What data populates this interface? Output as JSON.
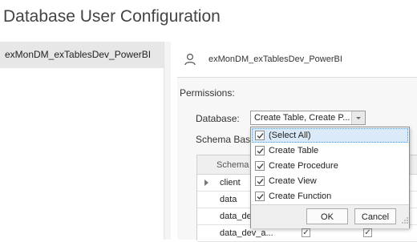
{
  "page": {
    "title": "Database User Configuration"
  },
  "users": {
    "items": [
      {
        "label": "exMonDM_exTablesDev_PowerBI",
        "selected": true
      }
    ]
  },
  "config": {
    "user_name": "exMonDM_exTablesDev_PowerBI",
    "permissions_label": "Permissions:",
    "database_label": "Database:",
    "database_value": "Create Table, Create P...",
    "schema_label": "Schema Bas",
    "grid": {
      "column_header": "Schema",
      "column_header_2": "e",
      "rows": [
        "client",
        "data",
        "data_de",
        "data_dev_a..."
      ]
    }
  },
  "dropdown": {
    "options": [
      {
        "label": "(Select All)",
        "checked": true
      },
      {
        "label": "Create Table",
        "checked": true
      },
      {
        "label": "Create Procedure",
        "checked": true
      },
      {
        "label": "Create View",
        "checked": true
      },
      {
        "label": "Create Function",
        "checked": true
      }
    ],
    "ok_label": "OK",
    "cancel_label": "Cancel"
  },
  "colors": {
    "highlight": "#dbeaf8",
    "selected_user": "#e7e7e7"
  }
}
